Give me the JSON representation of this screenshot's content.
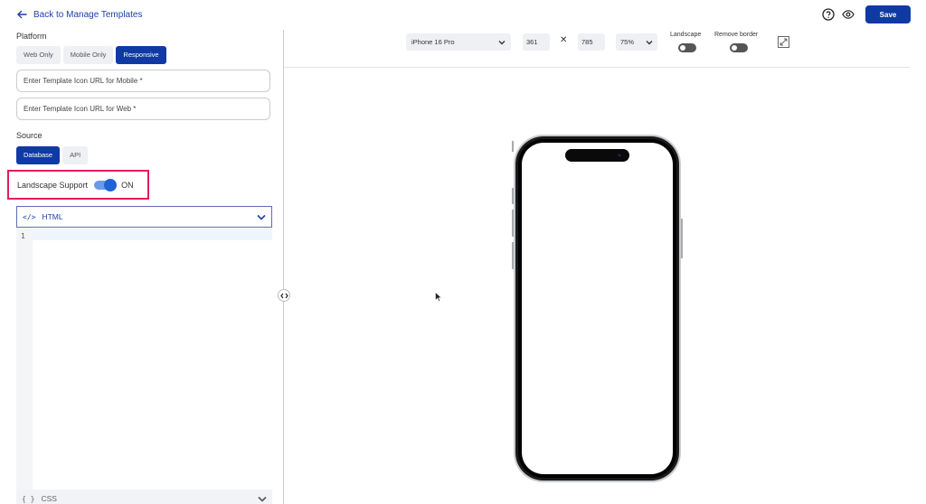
{
  "header": {
    "back_label": "Back to Manage Templates",
    "save_label": "Save"
  },
  "platform": {
    "label": "Platform",
    "options": [
      "Web Only",
      "Mobile Only",
      "Responsive"
    ],
    "selected": "Responsive"
  },
  "inputs": {
    "mobile_icon_placeholder": "Enter Template Icon URL for Mobile *",
    "web_icon_placeholder": "Enter Template Icon URL for Web *"
  },
  "source": {
    "label": "Source",
    "options": [
      "Database",
      "API"
    ],
    "selected": "Database"
  },
  "landscape_support": {
    "label": "Landscape Support",
    "state": "ON"
  },
  "editor": {
    "html_tab": "HTML",
    "css_tab": "CSS",
    "line_number": "1",
    "html_icon": "</>",
    "css_icon": "{ }"
  },
  "toolbar": {
    "device": "iPhone 16 Pro",
    "width": "361",
    "times": "✕",
    "height": "785",
    "zoom": "75%",
    "landscape_label": "Landscape",
    "remove_border_label": "Remove border"
  },
  "colors": {
    "primary": "#0f3aa4",
    "highlight": "#e6195e",
    "toggle_on": "#1f64d6"
  }
}
